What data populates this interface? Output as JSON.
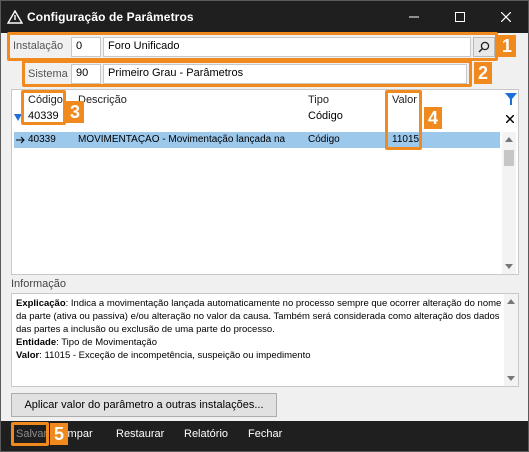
{
  "window": {
    "title": "Configuração de Parâmetros"
  },
  "instalacao": {
    "label": "Instalação",
    "code": "0",
    "name": "Foro Unificado"
  },
  "sistema": {
    "label": "Sistema",
    "code": "90",
    "name": "Primeiro Grau - Parâmetros"
  },
  "grid": {
    "headers": {
      "codigo": "Código",
      "descricao": "Descrição",
      "tipo": "Tipo",
      "valor": "Valor"
    },
    "filter": {
      "codigo": "40339",
      "tipo": "Código"
    },
    "rows": [
      {
        "codigo": "40339",
        "descricao": "MOVIMENTAÇÃO - Movimentação lançada na",
        "tipo": "Código",
        "valor": "11015"
      }
    ]
  },
  "info": {
    "label": "Informação",
    "explicacao_label": "Explicação",
    "explicacao": ": Indica a movimentação lançada automaticamente no processo sempre que ocorrer alteração do nome da parte (ativa ou passiva) e/ou alteração no valor da causa. Também será considerada como alteração dos dados das partes a inclusão ou exclusão de uma parte do processo.",
    "entidade_label": "Entidade",
    "entidade": ": Tipo de Movimentação",
    "valor_label": "Valor",
    "valor": ": 11015 - Exceção de incompetência, suspeição ou impedimento"
  },
  "apply_button": "Aplicar valor do parâmetro a outras instalações...",
  "footer": {
    "salvar": "Salvar",
    "limpar": "Limpar",
    "restaurar": "Restaurar",
    "relatorio": "Relatório",
    "fechar": "Fechar"
  },
  "callouts": [
    "1",
    "2",
    "3",
    "4",
    "5"
  ],
  "colors": {
    "accent": "#f08a1e",
    "selection": "#9cc8ec",
    "titlebar": "#1f1f1f",
    "filter_icon": "#1e6fd9"
  }
}
